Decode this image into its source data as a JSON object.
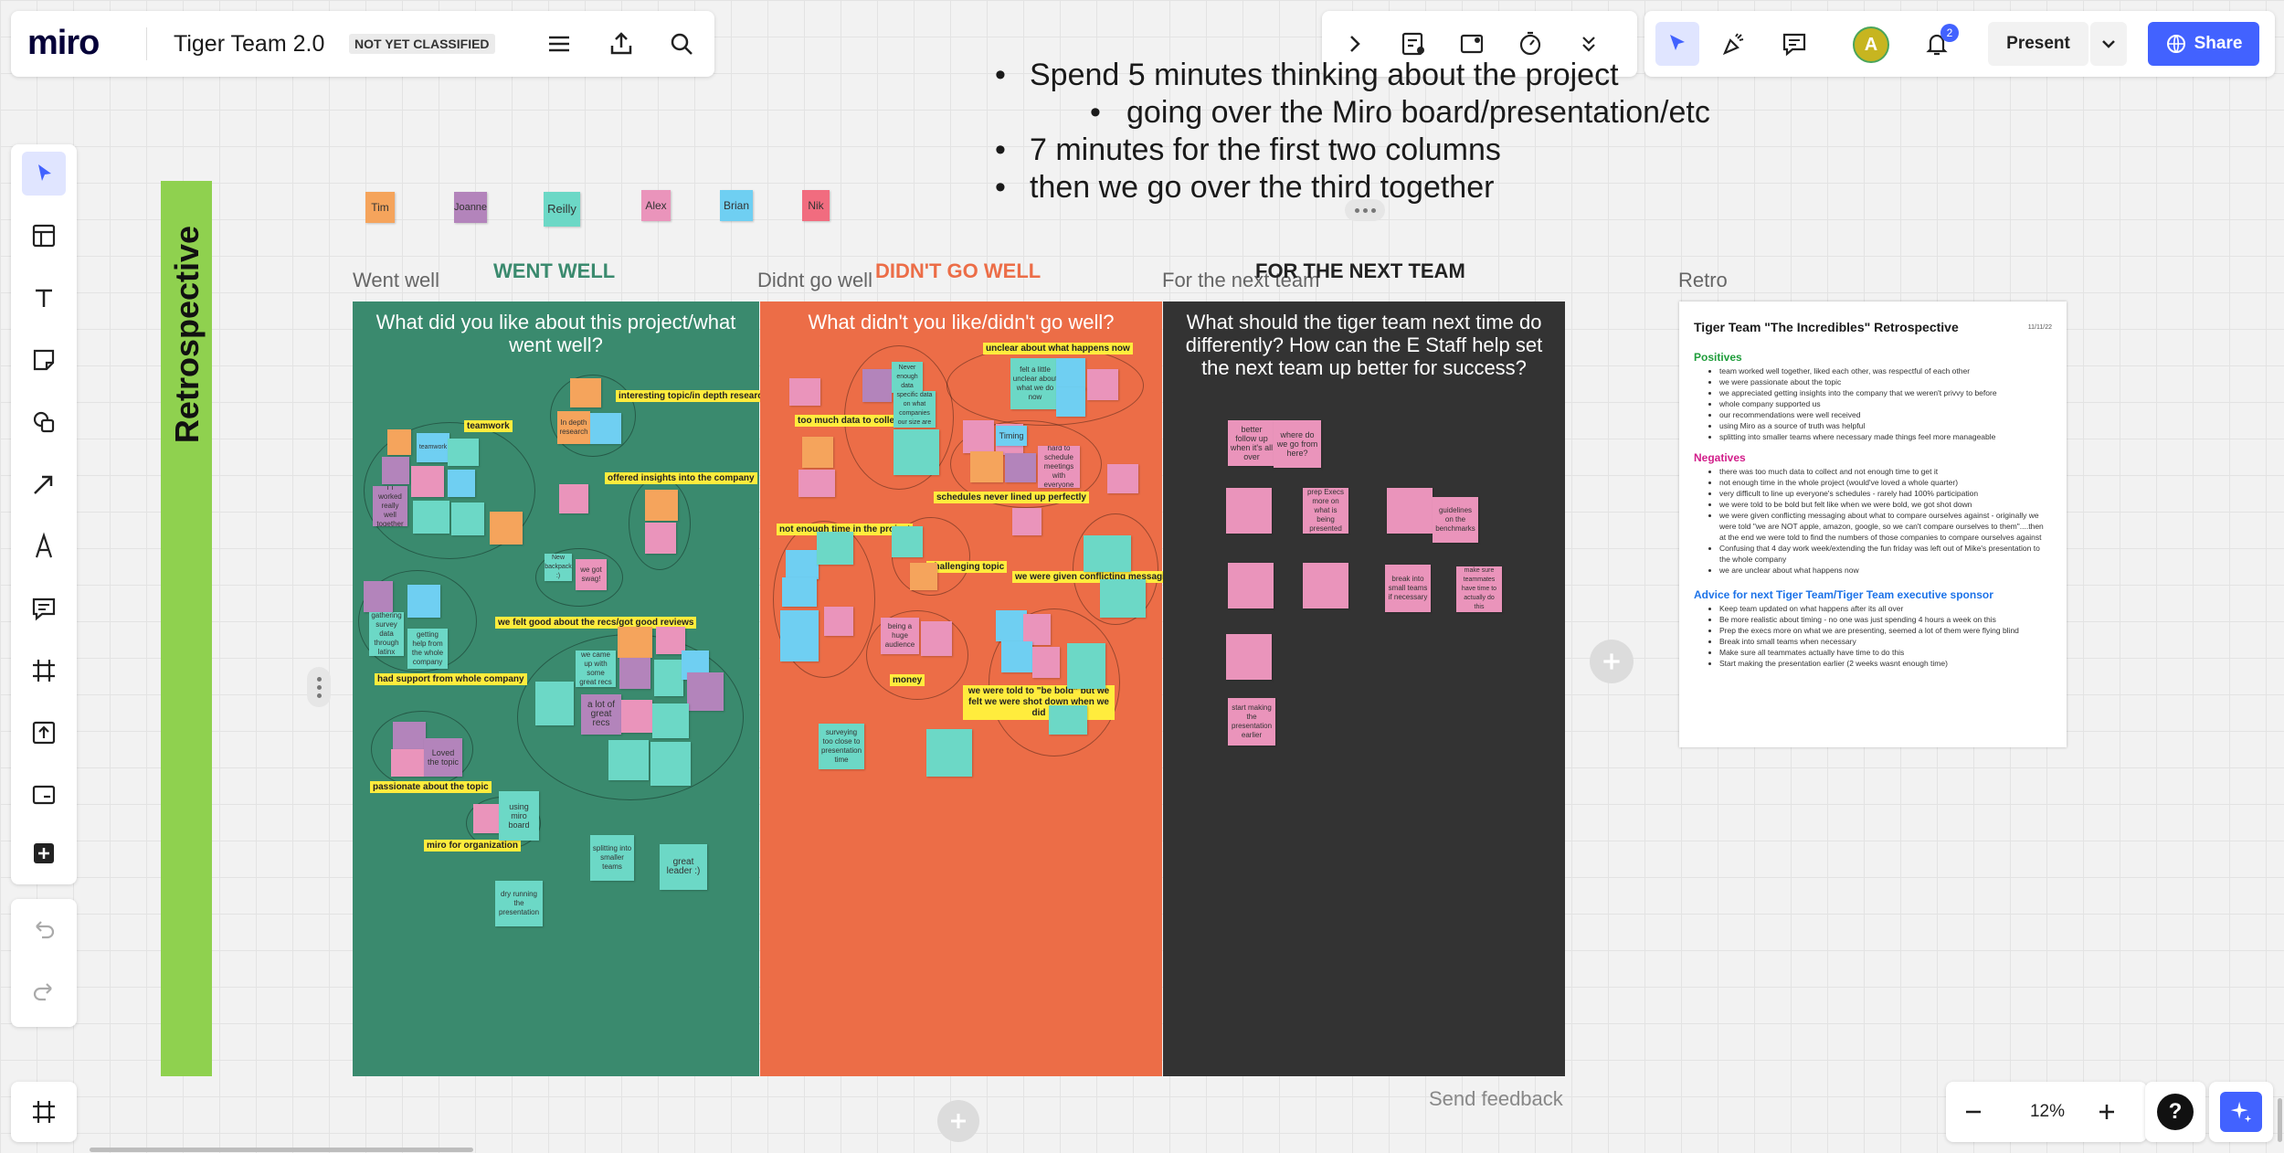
{
  "app": {
    "logo": "miro",
    "board_title": "Tiger Team 2.0",
    "classification": "NOT YET CLASSIFIED"
  },
  "toolbar_right": {
    "present_label": "Present",
    "share_label": "Share",
    "avatar_letter": "A",
    "notifications_count": "2"
  },
  "zoom": {
    "level": "12%",
    "help": "?"
  },
  "send_feedback": "Send feedback",
  "instructions": [
    "Spend 5 minutes thinking about the project",
    "going over the Miro board/presentation/etc",
    "7 minutes for the first two columns",
    "then we go over the third together"
  ],
  "frame_title": "Retrospective",
  "people": [
    "Tim",
    "Joanne",
    "Reilly",
    "Alex",
    "Brian",
    "Nik"
  ],
  "columns": {
    "went_well": {
      "label": "Went well",
      "title": "WENT WELL",
      "question": "What did you like about this project/what went well?"
    },
    "didnt_go_well": {
      "label": "Didnt go well",
      "title": "DIDN'T GO WELL",
      "question": "What didn't you like/didn't go well?"
    },
    "next_team": {
      "label": "For the next team",
      "title": "FOR THE NEXT TEAM",
      "question": "What should the tiger team next time do differently? How can the E Staff help set the next team up better for success?"
    }
  },
  "went_well_tags": [
    "interesting topic/in depth research",
    "teamwork",
    "offered insights into the company",
    "we felt good about the recs/got good reviews",
    "had support from whole company",
    "passionate about the topic",
    "miro for organization"
  ],
  "went_well_notes": [
    "In depth research",
    "TT worked really well together",
    "New backpack :)",
    "we got swag!",
    "gathering survey data through latinx",
    "getting help from the whole company",
    "we came up with some great recs",
    "a lot of great recs",
    "Loved the topic",
    "using miro board",
    "splitting into smaller teams",
    "great leader :)",
    "dry running the presentation",
    "teamwork"
  ],
  "didnt_tags": [
    "unclear about what happens now",
    "too much data to collect",
    "schedules never lined up perfectly",
    "not enough time in the project",
    "challenging topic",
    "we were given conflicting messaging",
    "money",
    "we were told to \"be bold\" but we felt we were shot down when we did"
  ],
  "didnt_notes": [
    "Never enough data",
    "hard to find specific data on what companies our size are doing",
    "felt a little unclear about what we do now",
    "Timing",
    "hard to schedule meetings with everyone",
    "being a huge audience",
    "surveying too close to presentation time"
  ],
  "next_notes": [
    "better follow up when it's all over",
    "where do we go from here?",
    "prep Execs more on what is being presented",
    "guidelines on the benchmarks",
    "break into small teams if necessary",
    "make sure teammates have time to actually do this",
    "start making the presentation earlier"
  ],
  "retro_doc": {
    "label": "Retro",
    "title": "Tiger Team \"The Incredibles\" Retrospective",
    "date": "11/11/22",
    "positives_heading": "Positives",
    "positives": [
      "team worked well together, liked each other, was respectful of each other",
      "we were passionate about the topic",
      "we appreciated getting insights into the company that we weren't privvy to before",
      "whole company supported us",
      "our recommendations were well received",
      "using Miro as a source of truth was helpful",
      "splitting into smaller teams where necessary made things feel more manageable"
    ],
    "negatives_heading": "Negatives",
    "negatives": [
      "there was too much data to collect and not enough time to get it",
      "not enough time in the whole project (would've loved a whole quarter)",
      "very difficult to line up everyone's schedules - rarely had 100% participation",
      "we were told to be bold but felt like when we were bold, we got shot down",
      "we were given conflicting messaging about what to compare ourselves against - originally we were told \"we are NOT apple, amazon, google, so we can't compare ourselves to them\"....then at the end we were told to find the numbers of those companies to compare ourselves against",
      "Confusing that 4 day work week/extending the fun friday was left out of Mike's presentation to the whole company",
      "we are unclear about what happens now"
    ],
    "advice_heading": "Advice for next Tiger Team/Tiger Team executive sponsor",
    "advice": [
      "Keep team updated on what happens after its all over",
      "Be more realistic about timing - no one was just spending 4 hours a week on this",
      "Prep the execs more on what we are presenting, seemed a lot of them were flying blind",
      "Break into small teams when necessary",
      "Make sure all teammates actually have time to do this",
      "Start making the presentation earlier (2 weeks wasnt enough time)"
    ]
  },
  "colors": {
    "accent": "#4262ff",
    "went_well_bg": "#3a8a6e",
    "didnt_bg": "#ec6d47",
    "next_bg": "#333333",
    "frame_bar": "#8fd14f"
  }
}
